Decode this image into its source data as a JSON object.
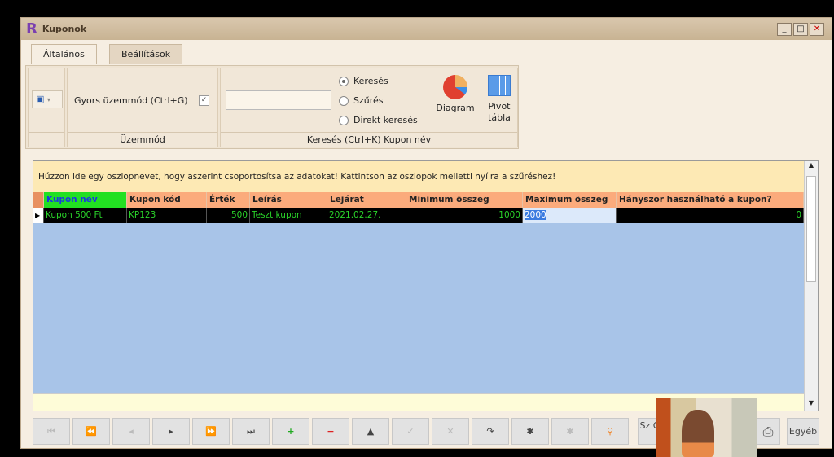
{
  "window": {
    "title": "Kuponok",
    "logo": "R"
  },
  "tabs": [
    {
      "label": "Általános",
      "active": true
    },
    {
      "label": "Beállítások",
      "active": false
    }
  ],
  "ribbon": {
    "mode_group": {
      "checkbox_label": "Gyors üzemmód (Ctrl+G)",
      "checked": true,
      "label": "Üzemmód"
    },
    "search_group": {
      "input_value": "",
      "options": [
        "Keresés",
        "Szűrés",
        "Direkt keresés"
      ],
      "selected": "Keresés",
      "label": "Keresés (Ctrl+K) Kupon név",
      "diagram": "Diagram",
      "pivot": "Pivot tábla"
    }
  },
  "grid": {
    "group_hint": "Húzzon ide egy oszlopnevet, hogy aszerint csoportosítsa az adatokat! Kattintson az oszlopok melletti nyílra a szűréshez!",
    "columns": [
      "Kupon név",
      "Kupon kód",
      "Érték",
      "Leírás",
      "Lejárat",
      "Minimum összeg",
      "Maximum összeg",
      "Hányszor használható a kupon?"
    ],
    "rows": [
      [
        "Kupon 500 Ft",
        "KP123",
        "500",
        "Teszt kupon",
        "2021.02.27.",
        "1000",
        "2000",
        "0"
      ]
    ]
  },
  "toolbar": {
    "buttons": [
      "⏮",
      "⏪",
      "◂",
      "▸",
      "⏩",
      "⏭",
      "+",
      "−",
      "▲",
      "✓",
      "✕",
      "↷",
      "✱",
      "✱",
      "⚲"
    ],
    "szures_partial": "Sz O",
    "other": "Egyéb"
  },
  "colors": {
    "header": "#fbab7c",
    "active_header": "#22e022",
    "row_bg": "#000000",
    "row_text": "#2ad42a",
    "grid_bg": "#a8c4e8"
  }
}
